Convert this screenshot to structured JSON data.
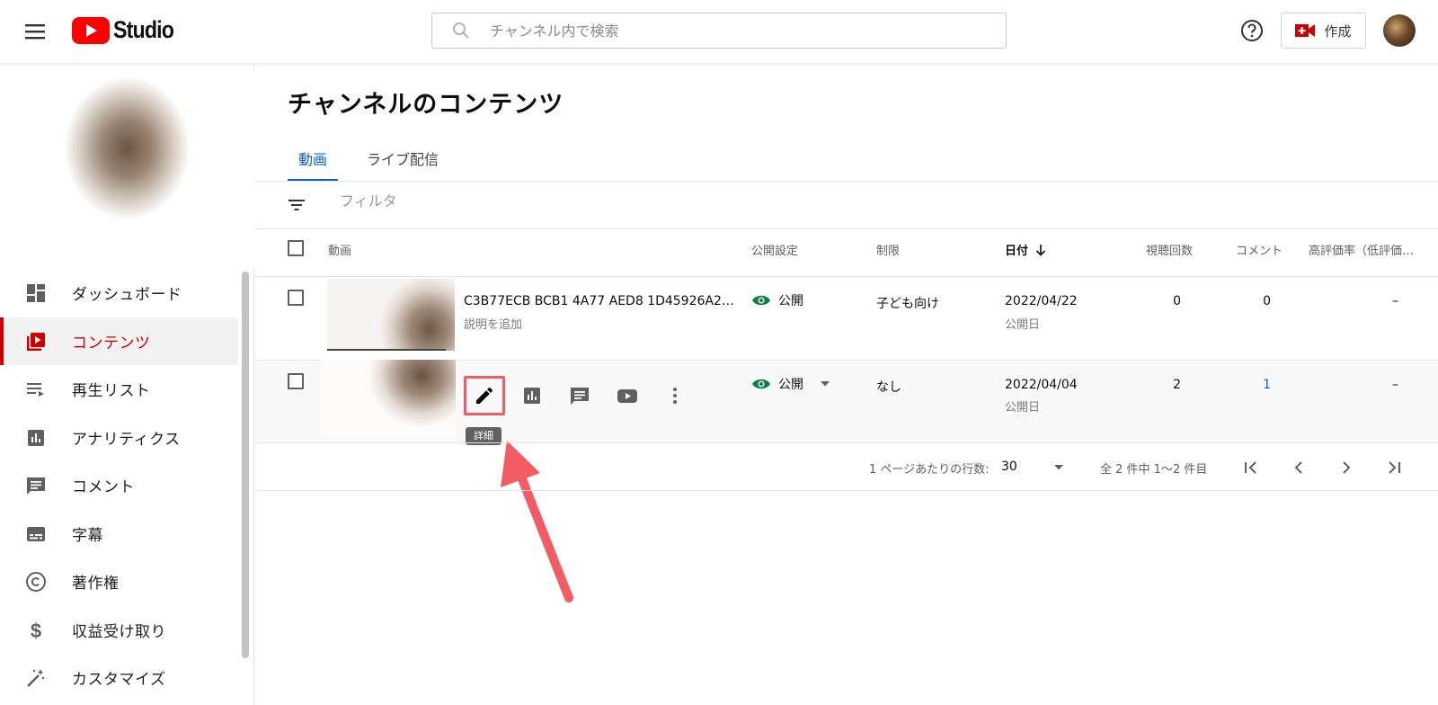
{
  "header": {
    "logo_text": "Studio",
    "search_placeholder": "チャンネル内で検索",
    "create_label": "作成"
  },
  "sidebar": {
    "items": [
      {
        "label": "ダッシュボード",
        "icon": "dashboard-icon",
        "active": false
      },
      {
        "label": "コンテンツ",
        "icon": "content-icon",
        "active": true
      },
      {
        "label": "再生リスト",
        "icon": "playlist-icon",
        "active": false
      },
      {
        "label": "アナリティクス",
        "icon": "analytics-icon",
        "active": false
      },
      {
        "label": "コメント",
        "icon": "comment-icon",
        "active": false
      },
      {
        "label": "字幕",
        "icon": "subtitles-icon",
        "active": false
      },
      {
        "label": "著作権",
        "icon": "copyright-icon",
        "active": false
      },
      {
        "label": "収益受け取り",
        "icon": "dollar-icon",
        "active": false
      },
      {
        "label": "カスタマイズ",
        "icon": "magic-wand-icon",
        "active": false
      }
    ]
  },
  "main": {
    "title": "チャンネルのコンテンツ",
    "tabs": [
      {
        "label": "動画",
        "active": true
      },
      {
        "label": "ライブ配信",
        "active": false
      }
    ],
    "filter_placeholder": "フィルタ",
    "columns": {
      "video": "動画",
      "visibility": "公開設定",
      "restriction": "制限",
      "date": "日付",
      "views": "視聴回数",
      "comments": "コメント",
      "likes": "高評価率（低評価…"
    },
    "rows": [
      {
        "title": "C3B77ECB BCB1 4A77 AED8 1D45926A2…",
        "description": "説明を追加",
        "visibility": "公開",
        "restriction": "子ども向け",
        "date": "2022/04/22",
        "date_label": "公開日",
        "views": "0",
        "comments": "0",
        "likes": "–"
      },
      {
        "title": "",
        "description": "",
        "visibility": "公開",
        "restriction": "なし",
        "date": "2022/04/04",
        "date_label": "公開日",
        "views": "2",
        "comments": "1",
        "likes": "–"
      }
    ],
    "hover_actions": [
      "pencil-icon",
      "analytics-icon",
      "comment-icon",
      "youtube-icon",
      "more-vert-icon"
    ],
    "tooltip": "詳細",
    "pagination": {
      "rows_per_page_label": "1 ページあたりの行数:",
      "rows_per_page_value": "30",
      "range_text": "全 2 件中 1〜2 件目"
    }
  },
  "colors": {
    "accent_blue": "#065fd4",
    "brand_red": "#cc0000",
    "public_green": "#0b8043",
    "highlight": "#f25c64"
  }
}
